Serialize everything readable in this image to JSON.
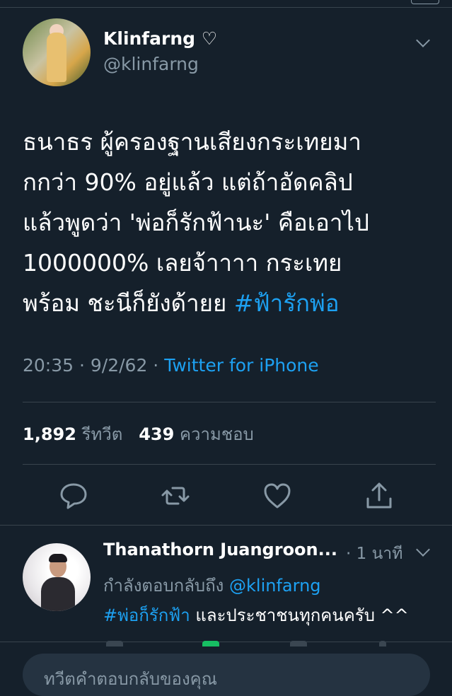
{
  "tweet": {
    "author_name": "Klinfarng ♡",
    "author_handle": "@klinfarng",
    "text_lines": [
      "ธนาธร ผู้ครองฐานเสียงกระเทยมา",
      "กกว่า 90% อยู่แล้ว แต่ถ้าอัดคลิป",
      "แล้วพูดว่า 'พ่อก็รักฟ้านะ' คือเอาไป",
      "1000000% เลยจ้าาาา กระเทย"
    ],
    "last_line_text": "พร้อม ชะนีก็ยังด้ายย ",
    "hashtag": "#ฟ้ารักพ่อ",
    "time": "20:35 · 9/2/62 · ",
    "source": "Twitter for iPhone",
    "retweets_count": "1,892",
    "retweets_label": "รีทวีต",
    "likes_count": "439",
    "likes_label": "ความชอบ"
  },
  "actions": [
    {
      "name": "reply-icon"
    },
    {
      "name": "retweet-icon"
    },
    {
      "name": "like-icon"
    },
    {
      "name": "share-icon"
    }
  ],
  "reply": {
    "author_name": "Thanathorn Juangroon...",
    "time": "· 1 นาที",
    "replying_prefix": "กำลังตอบกลับถึง ",
    "replying_mention": "@klinfarng",
    "hashtag": "#พ่อก็รักฟ้า",
    "body": " และประชาชนทุกคนครับ ^^"
  },
  "compose": {
    "placeholder": "ทวีตคำตอบกลับของคุณ"
  },
  "colors": {
    "background": "#15202b",
    "accent": "#1da1f2",
    "muted": "#8899a6",
    "divider": "#38444d"
  }
}
